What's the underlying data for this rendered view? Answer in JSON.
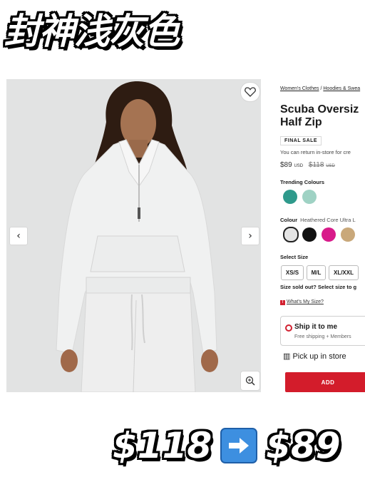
{
  "overlay": {
    "title": "封神浅灰色",
    "price_old": "$118",
    "price_new": "$89",
    "arrow_icon": "right-arrow-icon"
  },
  "product": {
    "breadcrumb": [
      "Women's Clothes",
      "/",
      "Hoodies & Swea"
    ],
    "title_line1": "Scuba Oversiz",
    "title_line2": "Half Zip",
    "badge": "FINAL SALE",
    "return_note": "You can return in-store for cre",
    "price": "$89",
    "price_currency": "USD",
    "price_old": "$118",
    "price_old_currency": "USD",
    "trending_label": "Trending Colours",
    "trending_colours": [
      "#2f9a8c",
      "#9fd2c4"
    ],
    "colour_label": "Colour",
    "colour_value": "Heathered Core Ultra L",
    "colours": [
      "#e4e4e4",
      "#111111",
      "#d81b8a",
      "#c9a87a"
    ],
    "size_label": "Select Size",
    "sizes": [
      "XS/S",
      "M/L",
      "XL/XXL"
    ],
    "sold_out_note": "Size sold out? Select size to g",
    "whats_my_size": "What's My Size?",
    "ship_title": "Ship it to me",
    "ship_sub": "Free shipping + Members",
    "pickup": "Pick up in store",
    "add_button": "ADD"
  },
  "gallery": {
    "prev_icon": "chevron-left-icon",
    "next_icon": "chevron-right-icon",
    "wishlist_icon": "heart-icon",
    "zoom_icon": "zoom-in-icon",
    "accent": "#d31c2b"
  }
}
